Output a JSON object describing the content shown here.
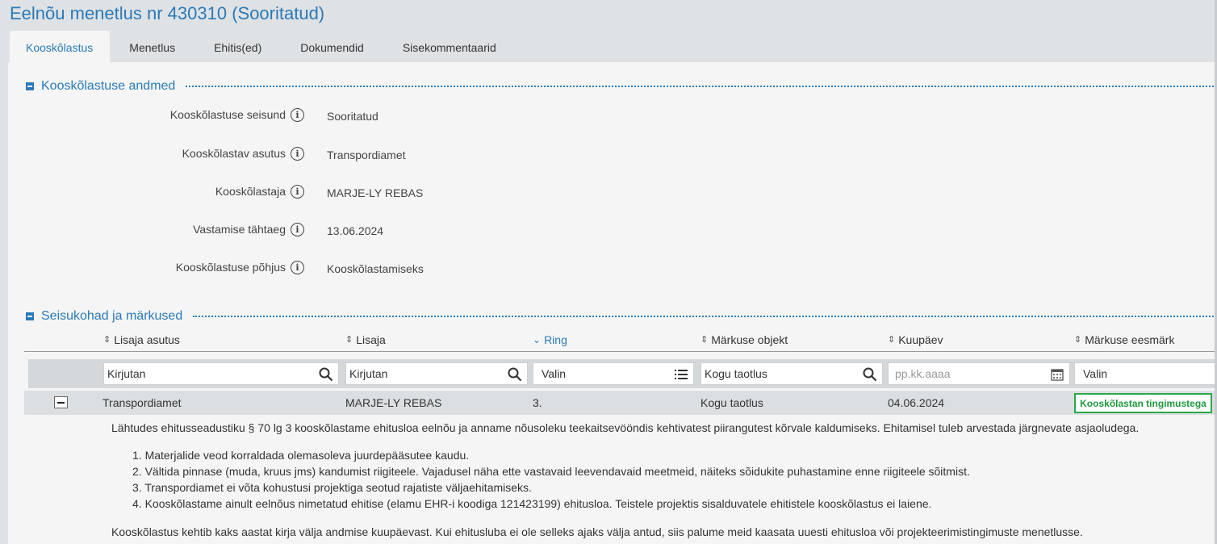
{
  "page_title": "Eelnõu menetlus nr 430310 (Sooritatud)",
  "tabs": [
    {
      "label": "Kooskõlastus",
      "active": true
    },
    {
      "label": "Menetlus"
    },
    {
      "label": "Ehitis(ed)"
    },
    {
      "label": "Dokumendid"
    },
    {
      "label": "Sisekommentaarid"
    }
  ],
  "section1": {
    "title": "Kooskõlastuse andmed",
    "fields": [
      {
        "label": "Kooskõlastuse seisund",
        "value": "Sooritatud"
      },
      {
        "label": "Kooskõlastav asutus",
        "value": "Transpordiamet"
      },
      {
        "label": "Kooskõlastaja",
        "value": "MARJE-LY REBAS"
      },
      {
        "label": "Vastamise tähtaeg",
        "value": "13.06.2024"
      },
      {
        "label": "Kooskõlastuse põhjus",
        "value": "Kooskõlastamiseks"
      }
    ],
    "info_icon_glyph": "i"
  },
  "section2": {
    "title": "Seisukohad ja märkused",
    "columns": [
      {
        "label": "Lisaja asutus",
        "sort_icon": "sort-both-icon"
      },
      {
        "label": "Lisaja",
        "sort_icon": "sort-both-icon"
      },
      {
        "label": "Ring",
        "sort_icon": "sort-desc-icon",
        "sorted": true
      },
      {
        "label": "Märkuse objekt",
        "sort_icon": "sort-both-icon"
      },
      {
        "label": "Kuupäev",
        "sort_icon": "sort-both-icon"
      },
      {
        "label": "Märkuse eesmärk",
        "sort_icon": "sort-both-icon"
      }
    ],
    "filters": {
      "lisaja_asutus": {
        "value": "Kirjutan",
        "icon": "search-icon"
      },
      "lisaja": {
        "value": "Kirjutan",
        "icon": "search-icon"
      },
      "ring": {
        "value": "Valin",
        "icon": "list-icon"
      },
      "markuse_objekt": {
        "value": "Kogu taotlus",
        "icon": "search-icon"
      },
      "kuupaev": {
        "placeholder": "pp.kk.aaaa",
        "icon": "calendar-icon"
      },
      "markuse_eesmark": {
        "value": "Valin"
      }
    },
    "row": {
      "lisaja_asutus": "Transpordiamet",
      "lisaja": "MARJE-LY REBAS",
      "ring": "3.",
      "markuse_objekt": "Kogu taotlus",
      "kuupaev": "04.06.2024",
      "markuse_eesmark": "Kooskõlastan tingimustega",
      "detail_intro": "Lähtudes ehitusseadustiku § 70 lg 3 kooskõlastame ehitusloa eelnõu ja anname nõusoleku teekaitsevööndis kehtivatest piirangutest kõrvale kaldumiseks. Ehitamisel tuleb arvestada järgnevate asjaoludega.",
      "detail_list": [
        "1. Materjalide veod korraldada olemasoleva juurdepääsutee kaudu.",
        "2. Vältida pinnase (muda, kruus jms) kandumist riigiteele. Vajadusel näha ette vastavaid leevendavaid meetmeid, näiteks sõidukite puhastamine enne riigiteele sõitmist.",
        "3. Transpordiamet ei võta kohustusi projektiga seotud rajatiste väljaehitamiseks.",
        "4. Kooskõlastame ainult eelnõus nimetatud ehitise (elamu EHR-i koodiga 121423199) ehitusloa. Teistele projektis sisalduvatele ehitistele kooskõlastus ei laiene."
      ],
      "detail_outro": "Kooskõlastus kehtib kaks aastat kirja välja andmise kuupäevast. Kui ehitusluba ei ole selleks ajaks välja antud, siis palume meid kaasata uuesti ehitusloa või projekteerimistingimuste menetlusse."
    }
  },
  "colors": {
    "accent": "#2a7ab8",
    "badge_green": "#2aa84a",
    "background": "#dfe2e5",
    "panel": "#f5f5f5"
  }
}
